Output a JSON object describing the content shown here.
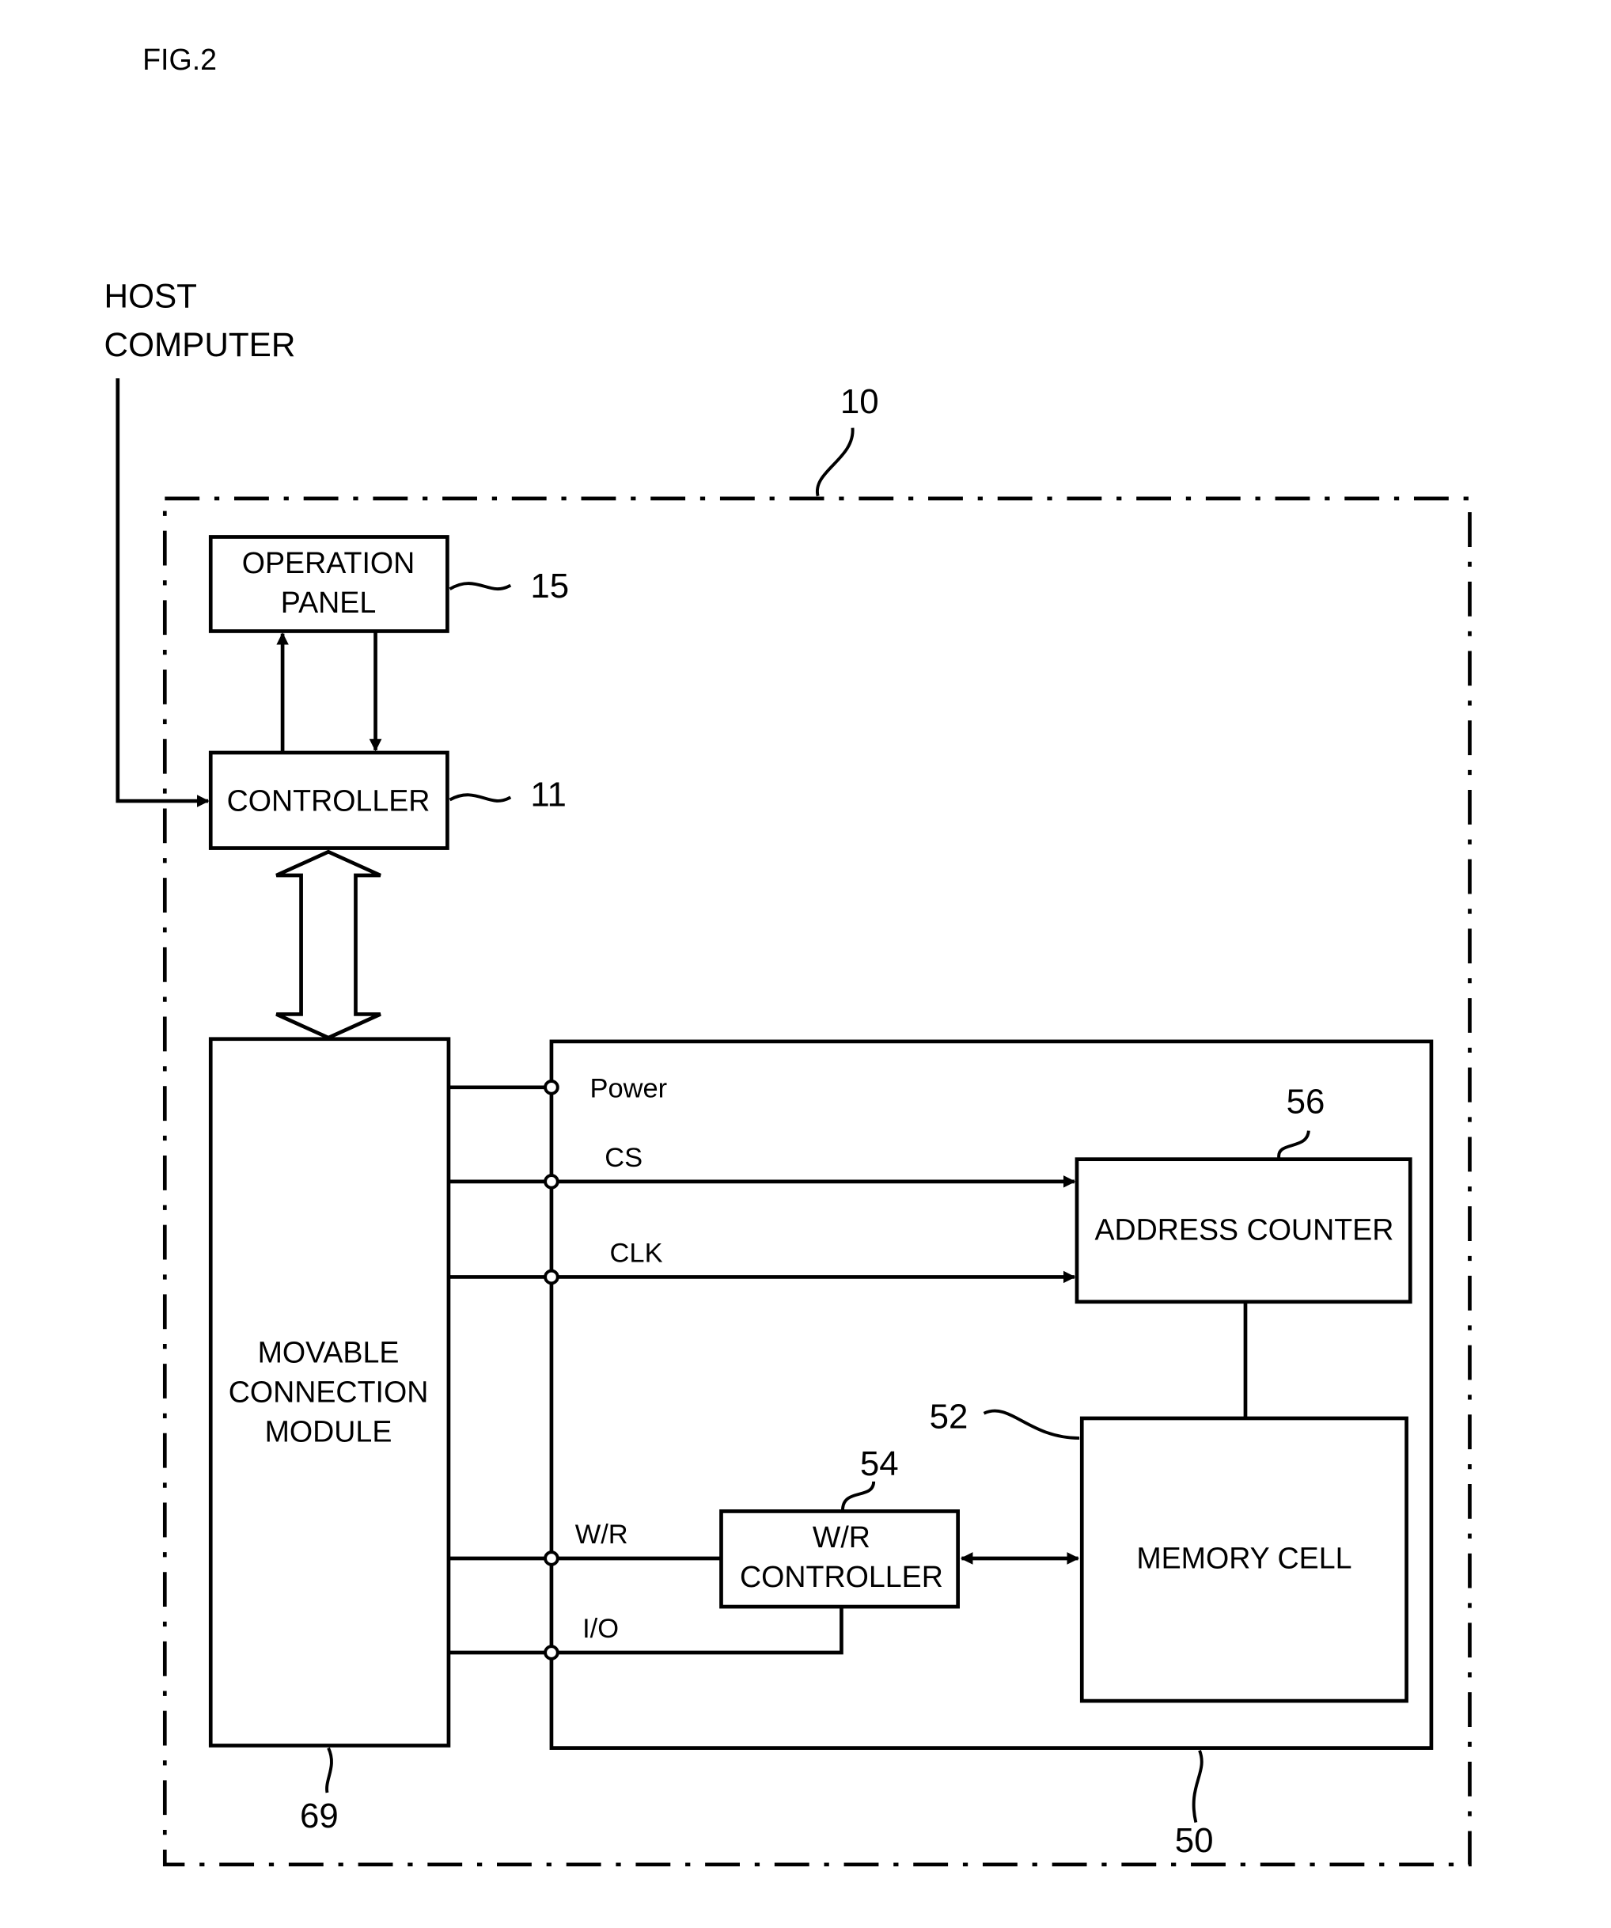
{
  "figure": {
    "title": "FIG.2"
  },
  "external": {
    "host_line1": "HOST",
    "host_line2": "COMPUTER"
  },
  "refs": {
    "device": "10",
    "operation_panel": "15",
    "controller": "11",
    "movable_connection_module": "69",
    "memory_unit": "50",
    "address_counter": "56",
    "memory_cell": "52",
    "wr_controller": "54"
  },
  "blocks": {
    "operation_panel": [
      "OPERATION",
      "PANEL"
    ],
    "controller": "CONTROLLER",
    "movable_connection_module": [
      "MOVABLE",
      "CONNECTION",
      "MODULE"
    ],
    "address_counter": "ADDRESS COUNTER",
    "memory_cell": "MEMORY CELL",
    "wr_controller": [
      "W/R",
      "CONTROLLER"
    ]
  },
  "signals": {
    "power": "Power",
    "cs": "CS",
    "clk": "CLK",
    "wr": "W/R",
    "io": "I/O"
  }
}
